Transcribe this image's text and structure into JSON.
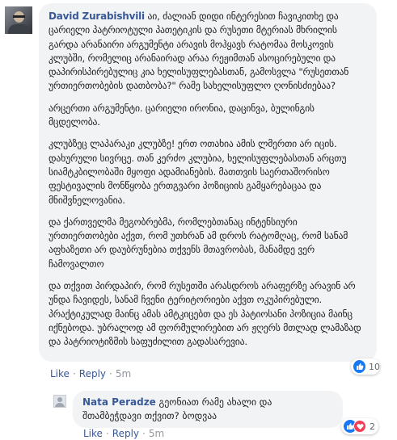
{
  "main_comment": {
    "author": "David Zurabishvili",
    "paragraphs": [
      "აი, ძალიან დიდი ინტერესით ჩავიკითხე და ცარიელი პატრიოტული პათეტიკის და რუსეთი მტერიას მხრილის გარდა არანაირი არგუმენტი არავის მოჰყავს რატომაა მოსკოვის კლუბში, რომელიც არანაირად არაა რეჟიმთან ასოცირებული და დაპირისპირებულიც კია ხელისუფლებასთან, გამოსვლა \"რუსეთთან ურთიერთობების დათბობა?\" რამე სახელისუფლო ღონისძიებაა?",
      "არცერთი არგუმენტი. ცარიელი ირონია, დაცინვა, ბულინგის მცდელობა.",
      "კლუბზეც ლაპარაკი კლუბზე! ერთ ოთახია ამის ლმერთი არ იცის. დახურული სივრცე. თან კერძო კლუბია, ხელისუფლებასთან არცთუ სიამტკბილობაში მყოფი ადამიანების. მათთვის საერთაშორისო ფესტივალის მონწყობა ერთგვარი პოზიციის გამყარებაცაა და მნიშვნელოვანია.",
      "და ქართველმა მეგობრებმა, რომლებთანაც ინტენსიური ურთიერთობები აქვთ, რომ უთხრან ამ დროს რატომღაც, რომ სანამ აფხაზეთი არ დაუბრუნებია თქვენს მთავრობას, მანამდე ვერ ჩამოვალთო",
      "და თქვით პირდაპირ, რომ რუსეთში არასდროს არაფერზე არავინ არ უნდა ჩავიდეს, სანამ ჩვენი ტერიტორიები აქვთ ოკუპირებული. პრაქტიკულად მაინც ამას ამტკიცებთ და ეს პატიოსანი პოზიცია მაინც იქნებოდა. უბრალოდ ამ ფორმულირებით არ ჟღერს მთლად ლამაზად და პატრიოტიზმის საფუძილით გადასარევია."
    ],
    "actions": {
      "like": "Like",
      "reply": "Reply",
      "time": "5m"
    },
    "reaction_count": "10",
    "colors": {
      "link": "#385898",
      "like_badge": "#1877f2"
    }
  },
  "reply_comment": {
    "author": "Nata Peradze",
    "text": "გეონიათ რამე ახალი და შთამბეჭდავი თქვით? ბოდვაა",
    "actions": {
      "like": "Like",
      "reply": "Reply",
      "time": "5m"
    },
    "reaction_count": "2",
    "colors": {
      "heart_badge": "#f33e58"
    }
  }
}
